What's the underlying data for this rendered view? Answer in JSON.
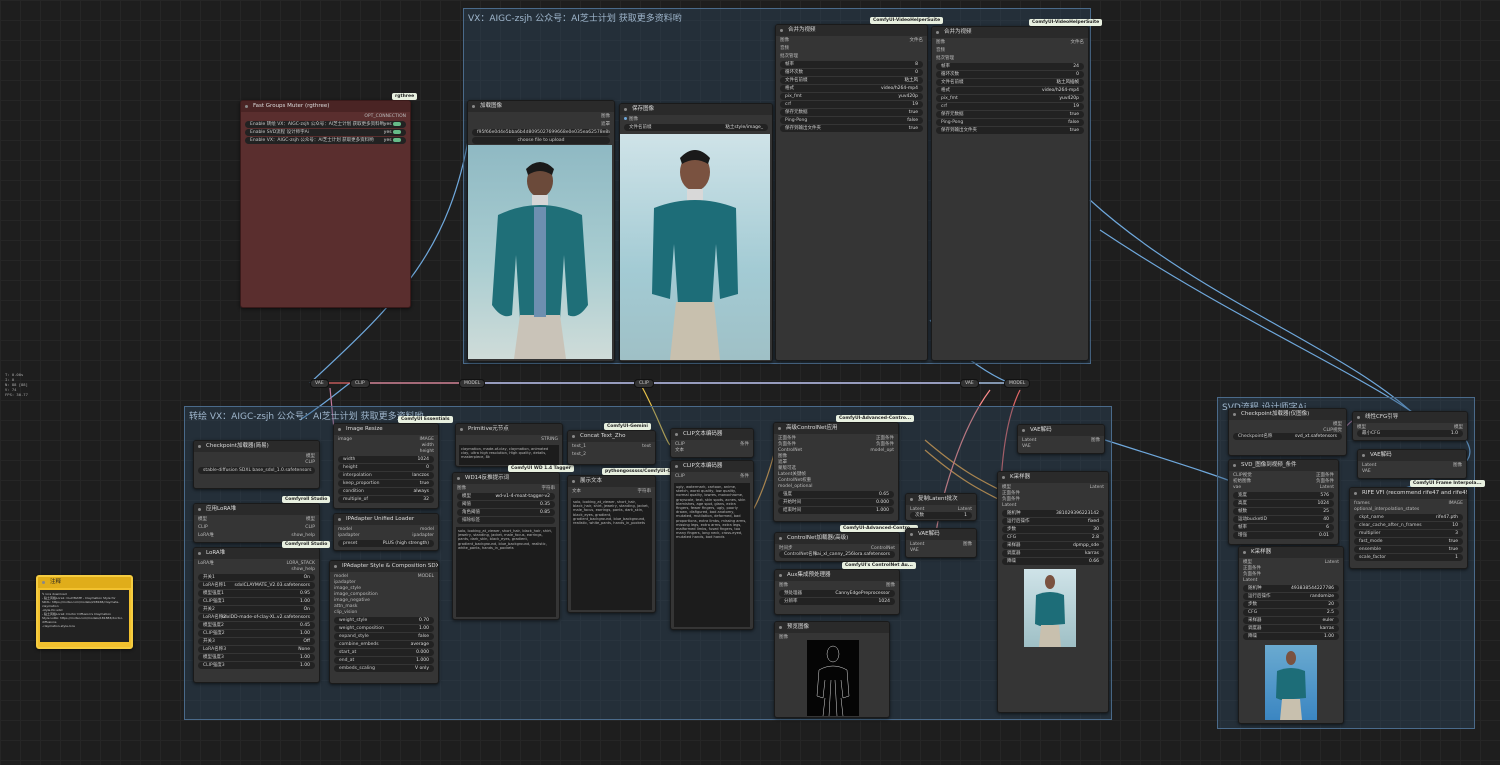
{
  "groups": {
    "top": "VX：AIGC-zsjh  公众号：AI芝士计划  获取更多资料哟",
    "main": "转绘  VX：AIGC-zsjh  公众号：AI芝士计划  获取更多资料哟",
    "svd": "SVD流程 设计师字Ai"
  },
  "badges": {
    "rgthree": "rgthree",
    "vhs1": "ComfyUI-VideoHelperSuite",
    "vhs2": "ComfyUI-VideoHelperSuite",
    "essentials": "ComfyUI Essentials",
    "gemini": "ComfyUI-Gemini",
    "advcontrol1": "ComfyUI-Advanced-Contro...",
    "advcontrol2": "ComfyUI-Advanced-Contro...",
    "controlnetaux": "ComfyUI's ControlNet Au...",
    "comfyroll1": "Comfyroll Studio",
    "comfyroll2": "Comfyroll Studio",
    "frameinterp": "ComfyUI Frame Interpola...",
    "wd14": "ComfyUI WD 1.4 Tagger",
    "pysss": "pythongosssss/ComfyUI-C..."
  },
  "fast_groups": {
    "title": "Fast Groups Muter (rgthree)",
    "output": "OPT_CONNECTION",
    "items": [
      {
        "label": "Enable 转绘  VX：AIGC-zsjh  公众号：AI芝士计划  获取更多资料哟",
        "value": "yes"
      },
      {
        "label": "Enable SVD流程 设计师字Ai",
        "value": "yes"
      },
      {
        "label": "Enable VX：AIGC-zsjh  公众号：AI芝士计划  获取更多资料哟",
        "value": "yes"
      }
    ]
  },
  "note": {
    "title": "注释",
    "lines": [
      "✎ lora download",
      "- 粘土风格Lora1: CLAYMATE - Claymation Style for",
      "SDXL: https://civitai.com/models/208168/claymate-claymation",
      "-style-for-sdxl",
      "- 粘土风格Lora2: Doctor Diffusion's Claymation",
      "Style LoRA: https://civitai.com/models/181883/doctor-diffusions",
      "-claymation-style-lora"
    ]
  },
  "left_info": [
    "T: 0.00s",
    "I: 0",
    "N: 88 [88]",
    "V: 74",
    "FPS: 30.77"
  ],
  "load_image": {
    "title": "加载图像",
    "outputs": [
      "图像",
      "遮罩"
    ],
    "filename": "f95f66e0d4e5bba6b4d8095027699668e0e035ea62578e88b-a32c5wp6_fw1200.jpg",
    "upload": "choose file to upload"
  },
  "save_image": {
    "title": "保存图像",
    "input": "图像",
    "label": "文件名前缀",
    "value": "粘土style/image_"
  },
  "combine1": {
    "title": "合并为视频",
    "inputs": [
      "图像",
      "音频",
      "批次管理"
    ],
    "output": "文件名",
    "rows": [
      {
        "label": "帧率",
        "value": "8"
      },
      {
        "label": "循环次数",
        "value": "0"
      },
      {
        "label": "文件名前缀",
        "value": "粘土风"
      },
      {
        "label": "格式",
        "value": "video/h264-mp4"
      },
      {
        "label": "pix_fmt",
        "value": "yuv420p"
      },
      {
        "label": "crf",
        "value": "19"
      },
      {
        "label": "保存元数据",
        "value": "true"
      },
      {
        "label": "Ping-Pong",
        "value": "false"
      },
      {
        "label": "保存到输出文件夹",
        "value": "true"
      }
    ]
  },
  "combine2": {
    "title": "合并为视频",
    "inputs": [
      "图像",
      "音频",
      "批次管理"
    ],
    "output": "文件名",
    "rows": [
      {
        "label": "帧率",
        "value": "24"
      },
      {
        "label": "循环次数",
        "value": "0"
      },
      {
        "label": "文件名前缀",
        "value": "粘土风插帧"
      },
      {
        "label": "格式",
        "value": "video/h264-mp4"
      },
      {
        "label": "pix_fmt",
        "value": "yuv420p"
      },
      {
        "label": "crf",
        "value": "19"
      },
      {
        "label": "保存元数据",
        "value": "true"
      },
      {
        "label": "Ping-Pong",
        "value": "false"
      },
      {
        "label": "保存到输出文件夹",
        "value": "true"
      }
    ]
  },
  "reroutes": {
    "vae1": "VAE",
    "clip1": "CLIP",
    "model1": "MODEL",
    "clip2": "CLIP",
    "vae2": "VAE",
    "model2": "MODEL"
  },
  "checkpoint1": {
    "title": "Checkpoint加载器(简易)",
    "outputs": [
      "模型",
      "CLIP",
      "VAE"
    ],
    "label": "Checkpoint名称",
    "value": "stable-diffusion SDXL base_sdxl_1.0.safetensors"
  },
  "lora_stack_apply": {
    "title": "应用LoRA堆",
    "inputs": [
      "模型",
      "CLIP",
      "LoRA堆"
    ],
    "outputs": [
      "模型",
      "CLIP",
      "show_help"
    ]
  },
  "lora_stack": {
    "title": "LoRA堆",
    "input": "LoRA堆",
    "outputs": [
      "LORA_STACK",
      "show_help"
    ],
    "rows": [
      {
        "label": "开关1",
        "value": "On"
      },
      {
        "label": "LoRA名称1",
        "value": "sdxlCLAYMATE_V2.03.safetensors"
      },
      {
        "label": "模型强度1",
        "value": "0.95"
      },
      {
        "label": "CLIP强度1",
        "value": "1.00"
      },
      {
        "label": "开关2",
        "value": "On"
      },
      {
        "label": "LoRA名称2",
        "value": "sdxlDD-made-of-clay-XL.v2.safetensors"
      },
      {
        "label": "模型强度2",
        "value": "0.45"
      },
      {
        "label": "CLIP强度2",
        "value": "1.00"
      },
      {
        "label": "开关3",
        "value": "Off"
      },
      {
        "label": "LoRA名称3",
        "value": "None"
      },
      {
        "label": "模型强度3",
        "value": "1.00"
      },
      {
        "label": "CLIP强度3",
        "value": "1.00"
      }
    ]
  },
  "image_resize": {
    "title": "Image Resize",
    "input": "image",
    "outputs": [
      "IMAGE",
      "width",
      "height"
    ],
    "rows": [
      {
        "label": "width",
        "value": "1024"
      },
      {
        "label": "height",
        "value": "0"
      },
      {
        "label": "interpolation",
        "value": "lanczos"
      },
      {
        "label": "keep_proportion",
        "value": "true"
      },
      {
        "label": "condition",
        "value": "always"
      },
      {
        "label": "multiple_of",
        "value": "32"
      }
    ]
  },
  "ipadapter_loader": {
    "title": "IPAdapter Unified Loader",
    "inputs": [
      "model",
      "ipadapter"
    ],
    "outputs": [
      "model",
      "ipadapter"
    ],
    "label": "preset",
    "value": "PLUS (high strength)"
  },
  "ipadapter_style": {
    "title": "IPAdapter Style & Composition SDXL",
    "output": "MODEL",
    "inputs": [
      "model",
      "ipadapter",
      "image_style",
      "image_composition",
      "image_negative",
      "attn_mask",
      "clip_vision"
    ],
    "rows": [
      {
        "label": "weight_style",
        "value": "0.70"
      },
      {
        "label": "weight_composition",
        "value": "1.00"
      },
      {
        "label": "expand_style",
        "value": "false"
      },
      {
        "label": "combine_embeds",
        "value": "average"
      },
      {
        "label": "start_at",
        "value": "0.000"
      },
      {
        "label": "end_at",
        "value": "1.000"
      },
      {
        "label": "embeds_scaling",
        "value": "V only"
      }
    ]
  },
  "primitive": {
    "title": "Primitive元节点",
    "output": "STRING",
    "text": "claymation, made-of-clay, claymation, animated clay, ultra high resolution, High quality, details, masterpiece, 8k"
  },
  "wd14": {
    "title": "WD14反推提示词",
    "input": "图像",
    "output": "字符串",
    "rows": [
      {
        "label": "模型",
        "value": "wd-v1-4-moat-tagger-v2"
      },
      {
        "label": "阈值",
        "value": "0.35"
      },
      {
        "label": "角色阈值",
        "value": "0.85"
      },
      {
        "label": "排除标签",
        "value": ""
      }
    ],
    "text": "solo, looking_at_viewer, short_hair, black_hair, shirt, jewelry, standing, jacket, male_focus, earrings, pants, dark_skin, black_eyes, gradient, gradient_background, blue_background, realistic, white_pants, hands_in_pockets"
  },
  "concat": {
    "title": "Concat Text_Zho",
    "inputs": [
      "text_1",
      "text_2"
    ],
    "output": "text"
  },
  "show_text": {
    "title": "展示文本",
    "input": "文本",
    "output": "字符串",
    "text": "solo, looking_at_viewer, short_hair, black_hair, shirt, jewelry, standing, jacket, male_focus, earrings, pants, dark_skin, black_eyes, gradient, gradient_background, blue_background, realistic, white_pants, hands_in_pockets"
  },
  "clip_pos": {
    "title": "CLIP文本编码器",
    "inputs": [
      "CLIP",
      "文本"
    ],
    "output": "条件"
  },
  "clip_neg": {
    "title": "CLIP文本编码器",
    "inputs": [
      "CLIP"
    ],
    "output": "条件",
    "text": "ugly, watermark, cartoon, anime, sketch, worst quality, low quality, normal quality, lowres, monochrome, grayscale, text, skin spots, acnes, skin blemishes, age spot, glans, extra fingers, fewer fingers, ugly, poorly drawn, disfigured, bad anatomy, mutated, mutilation, deformed, bad proportions, extra limbs, missing arms, missing legs, extra arms, extra legs, malformed limbs, fused fingers, too many fingers, long neck, cross-eyed, mutated hands, bad hands"
  },
  "apply_controlnet": {
    "title": "高级ControlNet应用",
    "inputs": [
      "正面条件",
      "负面条件",
      "ControlNet",
      "图像",
      "遮罩",
      "蒙版可选",
      "Latent关键帧",
      "ControlNet权重",
      "model_optional"
    ],
    "outputs": [
      "正面条件",
      "负面条件",
      "model_opt"
    ],
    "rows": [
      {
        "label": "强度",
        "value": "0.65"
      },
      {
        "label": "开始时间",
        "value": "0.000"
      },
      {
        "label": "结束时间",
        "value": "1.000"
      }
    ]
  },
  "controlnet_loader": {
    "title": "ControlNet加载器(高级)",
    "input": "时间步",
    "output": "ControlNet",
    "label": "ControlNet名称",
    "value": "sai_xl_canny_256lora.safetensors"
  },
  "aux_preproc": {
    "title": "Aux集成预处理器",
    "input": "图像",
    "output": "图像",
    "rows": [
      {
        "label": "预处理器",
        "value": "CannyEdgePreprocessor"
      },
      {
        "label": "分辨率",
        "value": "1024"
      }
    ]
  },
  "preview": {
    "title": "预览图像",
    "input": "图像"
  },
  "empty_latent": {
    "title": "复制Latent批次",
    "input": "Latent",
    "output": "Latent",
    "rows": [
      {
        "label": "次数",
        "value": "1"
      }
    ]
  },
  "vae_decode_mid": {
    "title": "VAE解码",
    "inputs": [
      "Latent",
      "VAE"
    ],
    "output": "图像"
  },
  "vae_decode_top": {
    "title": "VAE解码",
    "inputs": [
      "Latent",
      "VAE"
    ],
    "output": "图像"
  },
  "ksampler1": {
    "title": "K采样器",
    "inputs": [
      "模型",
      "正面条件",
      "负面条件",
      "Latent"
    ],
    "output": "Latent",
    "rows": [
      {
        "label": "随机种",
        "value": "381029396223142"
      },
      {
        "label": "运行后操作",
        "value": "fixed"
      },
      {
        "label": "步数",
        "value": "30"
      },
      {
        "label": "CFG",
        "value": "2.8"
      },
      {
        "label": "采样器",
        "value": "dpmpp_sde"
      },
      {
        "label": "调度器",
        "value": "karras"
      },
      {
        "label": "降噪",
        "value": "0.66"
      }
    ]
  },
  "svd_checkpoint": {
    "title": "Checkpoint加载器(仅图像)",
    "outputs": [
      "模型",
      "CLIP视觉",
      "VAE"
    ],
    "label": "Checkpoint名称",
    "value": "svd_xt.safetensors"
  },
  "linear_cfg": {
    "title": "线性CFG引导",
    "input": "模型",
    "output": "模型",
    "rows": [
      {
        "label": "最小CFG",
        "value": "1.0"
      }
    ]
  },
  "svd_cond": {
    "title": "SVD_图像到视频_条件",
    "inputs": [
      "CLIP视觉",
      "初始图像",
      "vae"
    ],
    "outputs": [
      "正面条件",
      "负面条件",
      "Latent"
    ],
    "rows": [
      {
        "label": "宽度",
        "value": "576"
      },
      {
        "label": "高度",
        "value": "1024"
      },
      {
        "label": "帧数",
        "value": "25"
      },
      {
        "label": "运动bucketID",
        "value": "40"
      },
      {
        "label": "帧率",
        "value": "6"
      },
      {
        "label": "增强",
        "value": "0.01"
      }
    ]
  },
  "vae_decode_svd": {
    "title": "VAE解码",
    "inputs": [
      "Latent",
      "VAE"
    ],
    "output": "图像"
  },
  "rife": {
    "title": "RIFE VFI (recommend rife47 and rife49)",
    "inputs": [
      "frames",
      "optional_interpolation_states"
    ],
    "output": "IMAGE",
    "rows": [
      {
        "label": "ckpt_name",
        "value": "rife47.pth"
      },
      {
        "label": "clear_cache_after_n_frames",
        "value": "10"
      },
      {
        "label": "multiplier",
        "value": "3"
      },
      {
        "label": "fast_mode",
        "value": "true"
      },
      {
        "label": "ensemble",
        "value": "true"
      },
      {
        "label": "scale_factor",
        "value": "1"
      }
    ]
  },
  "ksampler2": {
    "title": "K采样器",
    "inputs": [
      "模型",
      "正面条件",
      "负面条件",
      "Latent"
    ],
    "output": "Latent",
    "rows": [
      {
        "label": "随机种",
        "value": "493838544227786"
      },
      {
        "label": "运行后操作",
        "value": "randomize"
      },
      {
        "label": "步数",
        "value": "20"
      },
      {
        "label": "CFG",
        "value": "2.5"
      },
      {
        "label": "采样器",
        "value": "euler"
      },
      {
        "label": "调度器",
        "value": "karras"
      },
      {
        "label": "降噪",
        "value": "1.00"
      }
    ]
  },
  "colors": {
    "group_bg": "#32506e",
    "node_bg": "#353535",
    "fast_groups_bg": "#5a2e2e",
    "note_bg": "#f2c12e"
  }
}
